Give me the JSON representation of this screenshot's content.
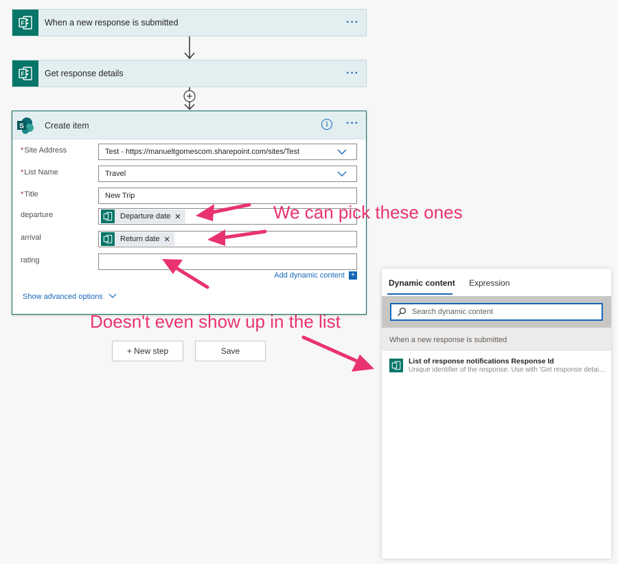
{
  "flow": {
    "trigger_title": "When a new response is submitted",
    "get_details_title": "Get response details",
    "more_label": "···"
  },
  "create_item": {
    "title": "Create item",
    "info_label": "i",
    "more_label": "···",
    "fields": {
      "site_address": {
        "label": "Site Address",
        "value": "Test - https://manueltgomescom.sharepoint.com/sites/Test"
      },
      "list_name": {
        "label": "List Name",
        "value": "Travel"
      },
      "title": {
        "label": "Title",
        "value": "New Trip"
      },
      "departure": {
        "label": "departure",
        "token": "Departure date"
      },
      "arrival": {
        "label": "arrival",
        "token": "Return date"
      },
      "rating": {
        "label": "rating",
        "value": ""
      }
    },
    "required_mark": "*",
    "token_remove": "✕",
    "add_dynamic_content": "Add dynamic content",
    "add_dynamic_plus": "+",
    "show_advanced": "Show advanced options"
  },
  "actions": {
    "new_step": "+ New step",
    "save": "Save"
  },
  "annotations": {
    "pick": "We can pick these ones",
    "missing": "Doesn't even show up in the list"
  },
  "dynamic_panel": {
    "tab_dynamic": "Dynamic content",
    "tab_expression": "Expression",
    "search_placeholder": "Search dynamic content",
    "section_title": "When a new response is submitted",
    "item_title": "List of response notifications Response Id",
    "item_desc": "Unique identifier of the response. Use with 'Get response details' action"
  },
  "colors": {
    "forms_green": "#077568",
    "link_blue": "#1467b8",
    "annotation_pink": "#e8336f"
  }
}
